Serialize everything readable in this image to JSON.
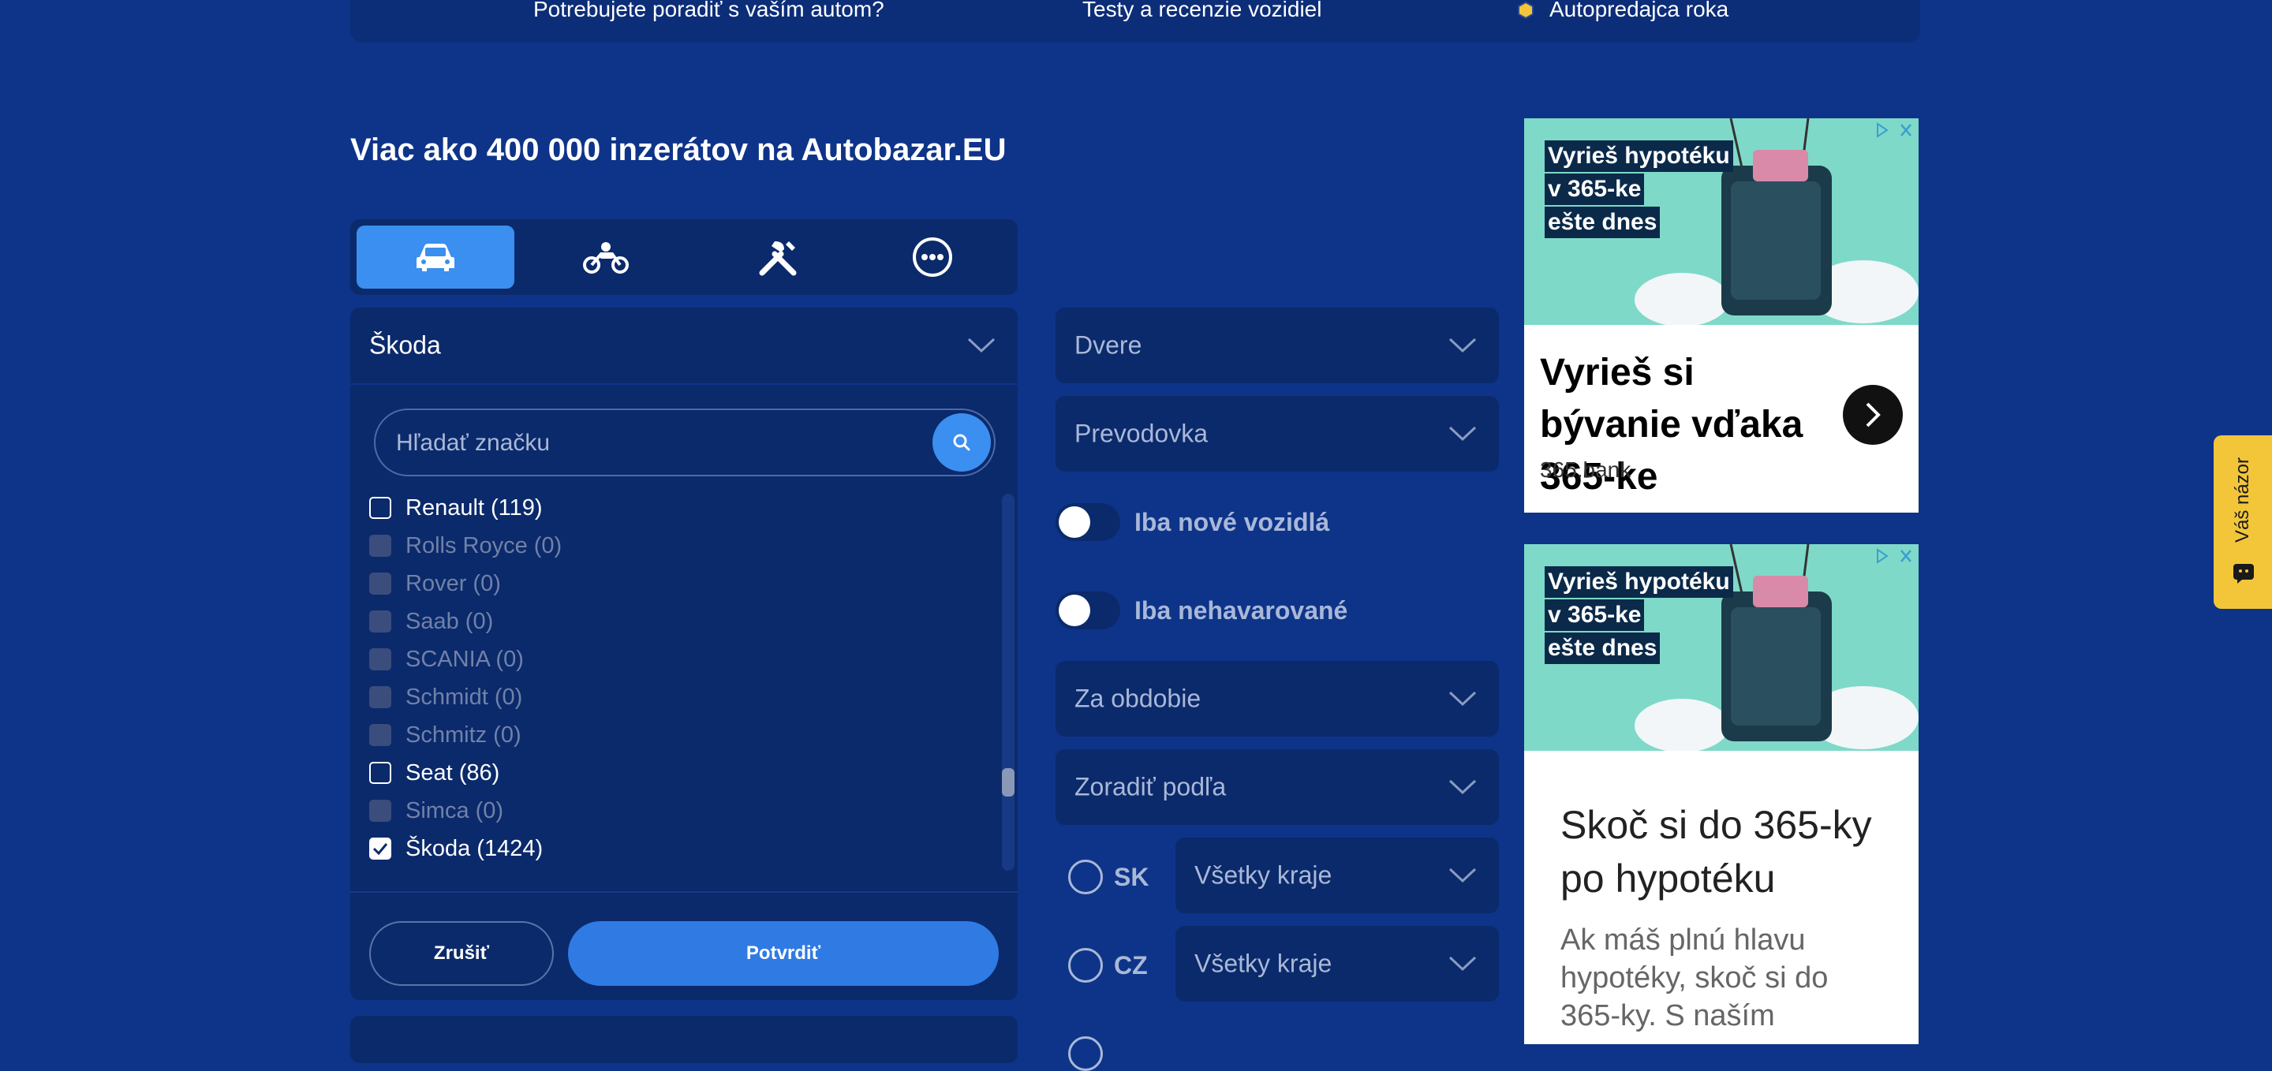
{
  "topnav": {
    "link1": "Potrebujete poradiť s vaším autom?",
    "link2": "Testy a recenzie vozidiel",
    "link3": "Autopredajca roka"
  },
  "headline": "Viac ako 400 000 inzerátov na Autobazar.EU",
  "tabs": [
    {
      "icon": "car-icon"
    },
    {
      "icon": "motorcycle-icon"
    },
    {
      "icon": "tools-icon"
    },
    {
      "icon": "more-icon"
    }
  ],
  "brand": {
    "selected": "Škoda",
    "search_placeholder": "Hľadať značku",
    "items": [
      {
        "label": "Renault (119)",
        "state": "enabled"
      },
      {
        "label": "Rolls Royce (0)",
        "state": "disabled"
      },
      {
        "label": "Rover (0)",
        "state": "disabled"
      },
      {
        "label": "Saab (0)",
        "state": "disabled"
      },
      {
        "label": "SCANIA (0)",
        "state": "disabled"
      },
      {
        "label": "Schmidt (0)",
        "state": "disabled"
      },
      {
        "label": "Schmitz (0)",
        "state": "disabled"
      },
      {
        "label": "Seat (86)",
        "state": "enabled"
      },
      {
        "label": "Simca (0)",
        "state": "disabled"
      },
      {
        "label": "Škoda (1424)",
        "state": "checked"
      }
    ],
    "cancel_label": "Zrušiť",
    "confirm_label": "Potvrdiť"
  },
  "filters": {
    "doors": "Dvere",
    "gearbox": "Prevodovka",
    "new_only": "Iba nové vozidlá",
    "undamaged_only": "Iba nehavarované",
    "period": "Za obdobie",
    "sort_by": "Zoradiť podľa"
  },
  "regions": [
    {
      "country": "SK",
      "region": "Všetky kraje"
    },
    {
      "country": "CZ",
      "region": "Všetky kraje"
    }
  ],
  "ads": {
    "banner_text": [
      "Vyrieš hypotéku",
      "v 365-ke",
      "ešte dnes"
    ],
    "ad1": {
      "title": "Vyrieš si bývanie vďaka 365-ke",
      "domain": "365.bank"
    },
    "ad2": {
      "title": "Skoč si do 365-ky po hypotéku",
      "body": "Ak máš plnú hlavu hypotéky, skoč si do 365-ky. S naším"
    }
  },
  "feedback": {
    "label": "Váš názor"
  },
  "colors": {
    "background": "#0e3489",
    "panel": "#0b2a6b",
    "accent": "#3a8ff0",
    "feedback": "#f3c63a"
  }
}
